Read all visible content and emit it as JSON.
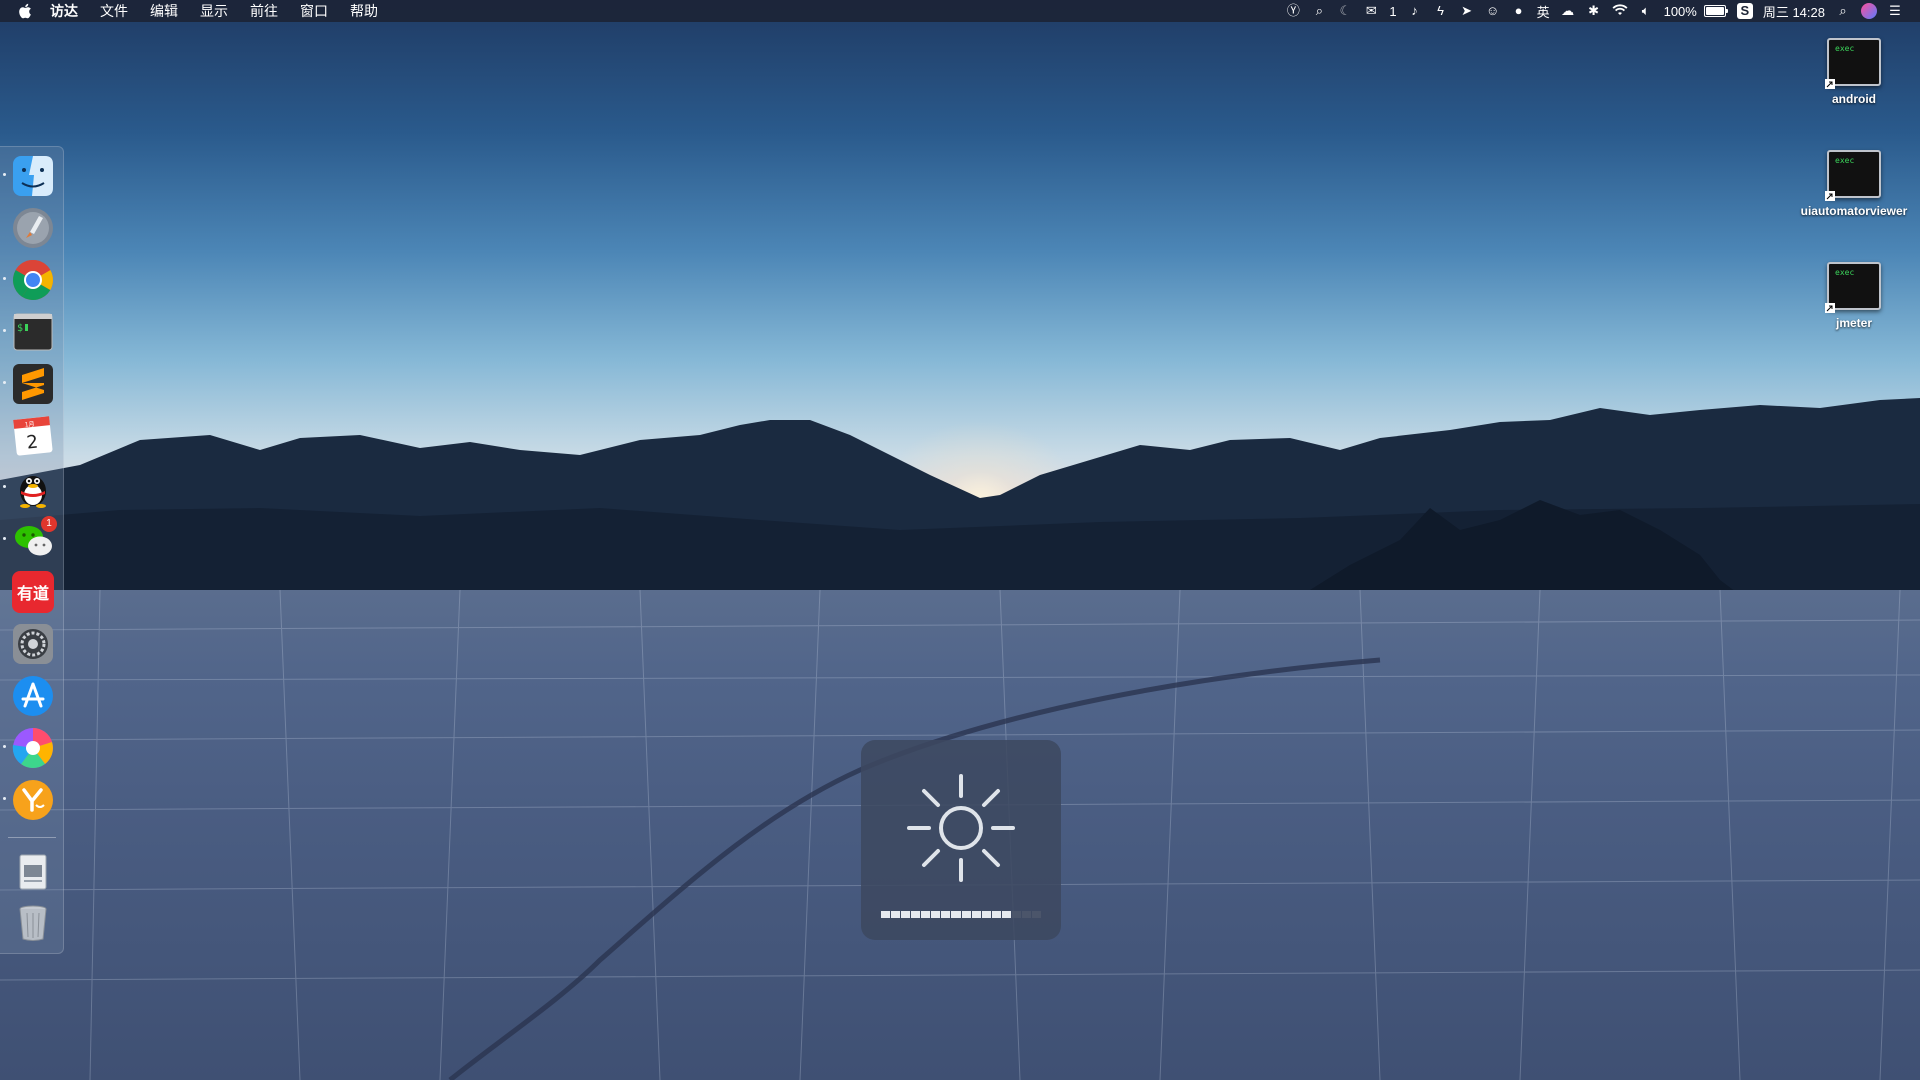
{
  "menubar": {
    "app_name": "访达",
    "menus": [
      "文件",
      "编辑",
      "显示",
      "前往",
      "窗口",
      "帮助"
    ],
    "tray": {
      "wechat_count": "1",
      "input_method": "英",
      "battery": "100%",
      "clock": "周三 14:28"
    }
  },
  "dock": {
    "items": [
      {
        "name": "Finder",
        "icon": "finder-icon",
        "running": true
      },
      {
        "name": "Launchpad",
        "icon": "launchpad-icon",
        "running": false
      },
      {
        "name": "Google Chrome",
        "icon": "chrome-icon",
        "running": true
      },
      {
        "name": "Terminal",
        "icon": "terminal-icon",
        "running": true
      },
      {
        "name": "Sublime Text",
        "icon": "sublime-icon",
        "running": true
      },
      {
        "name": "Calendar",
        "icon": "calendar-icon",
        "running": false,
        "month": "1月",
        "day": "2"
      },
      {
        "name": "QQ",
        "icon": "qq-icon",
        "running": true
      },
      {
        "name": "WeChat",
        "icon": "wechat-icon",
        "running": true,
        "badge": "1"
      },
      {
        "name": "有道",
        "icon": "youdao-icon",
        "running": false,
        "label": "有道"
      },
      {
        "name": "System Preferences",
        "icon": "gear-icon",
        "running": false
      },
      {
        "name": "App Store",
        "icon": "appstore-icon",
        "running": false
      },
      {
        "name": "Color app",
        "icon": "colorwheel-icon",
        "running": true
      },
      {
        "name": "Y app",
        "icon": "y-app-icon",
        "running": true
      },
      {
        "name": "Documents",
        "icon": "documents-icon",
        "running": false
      },
      {
        "name": "Trash",
        "icon": "trash-icon",
        "running": false
      }
    ]
  },
  "desktop": {
    "icons": [
      {
        "label": "android",
        "badge_text": "exec"
      },
      {
        "label": "uiautomatorviewer",
        "badge_text": "exec"
      },
      {
        "label": "jmeter",
        "badge_text": "exec"
      }
    ]
  },
  "hud": {
    "type": "brightness",
    "icon": "sun-icon",
    "level": 0.8,
    "segments": 16
  },
  "colors": {
    "menubar_bg": "#1c2436",
    "hud_bg": "#3c485f",
    "hud_fill": "#e5e9ef"
  }
}
